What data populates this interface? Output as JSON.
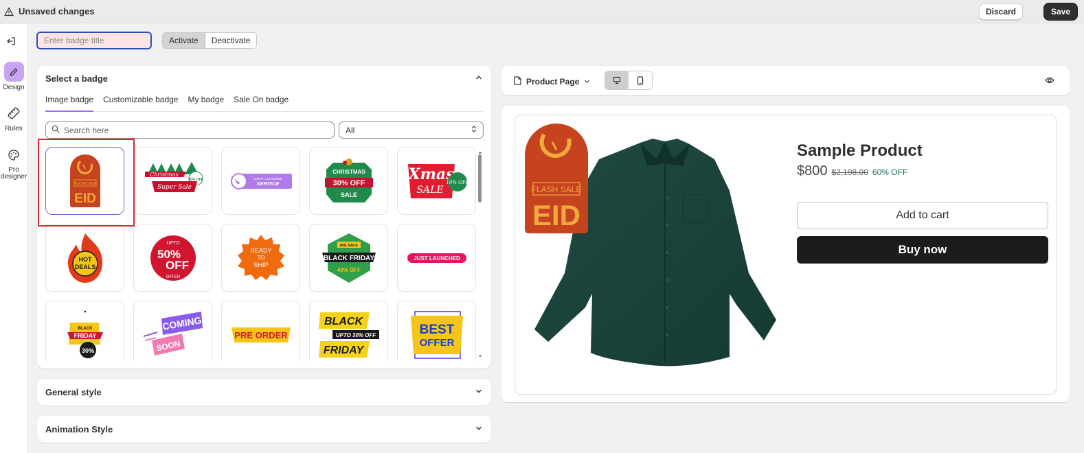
{
  "topbar": {
    "title": "Unsaved changes",
    "icon": "warning-icon",
    "discard_label": "Discard",
    "save_label": "Save"
  },
  "rail": {
    "items": [
      {
        "label": "Design",
        "icon": "pencil-icon",
        "active": true
      },
      {
        "label": "Rules",
        "icon": "ruler-icon"
      },
      {
        "label_line1": "Pro",
        "label_line2": "designer",
        "icon": "palette-icon"
      }
    ]
  },
  "toolbar": {
    "badge_title_placeholder": "Enter badge title",
    "badge_title_value": "",
    "activate_label": "Activate",
    "deactivate_label": "Deactivate"
  },
  "select_badge": {
    "title": "Select a badge",
    "tabs": [
      "Image badge",
      "Customizable badge",
      "My badge",
      "Sale On badge"
    ],
    "active_tab": "Image badge",
    "search_placeholder": "Search here",
    "filter_value": "All",
    "badges": [
      {
        "eyebrow": "FLASH SALE",
        "main": "EID"
      },
      {
        "line1": "Christmas",
        "line2": "Super Sale",
        "tag": "30% OFF"
      },
      {
        "line1": "GREAT CUSTOMER",
        "line2": "SERVICE"
      },
      {
        "line1": "CHRISTMAS",
        "line2": "30% OFF",
        "line3": "SALE"
      },
      {
        "line1": "Xmas",
        "line2": "SALE",
        "tag": "10% OFF"
      },
      {
        "line1": "HOT",
        "line2": "DEALS"
      },
      {
        "line1": "UPTO",
        "line2": "50%",
        "line3": "OFF",
        "line4": "OFFER"
      },
      {
        "line1": "READY",
        "line2": "TO",
        "line3": "SHIP"
      },
      {
        "line1": "BIG SALE",
        "line2": "BLACK FRIDAY",
        "line3": "40% OFF"
      },
      {
        "line1": "JUST LAUNCHED"
      },
      {
        "line1": "BLACK",
        "line2": "FRIDAY",
        "line3": "30%"
      },
      {
        "line1": "COMING",
        "line2": "SOON"
      },
      {
        "line1": "PRE ORDER"
      },
      {
        "line1": "BLACK",
        "line2": "UPTO 30% OFF",
        "line3": "FRIDAY"
      },
      {
        "line1": "BEST",
        "line2": "OFFER"
      }
    ]
  },
  "sections": {
    "general_style": "General style",
    "animation_style": "Animation Style"
  },
  "preview": {
    "page_select": "Product Page",
    "product": {
      "title": "Sample Product",
      "price": "$800",
      "compare_price": "$2,198.00",
      "discount": "60% OFF",
      "add_to_cart": "Add to cart",
      "buy_now": "Buy now"
    },
    "overlay_badge": {
      "eyebrow": "FLASH SALE",
      "main": "EID"
    }
  }
}
